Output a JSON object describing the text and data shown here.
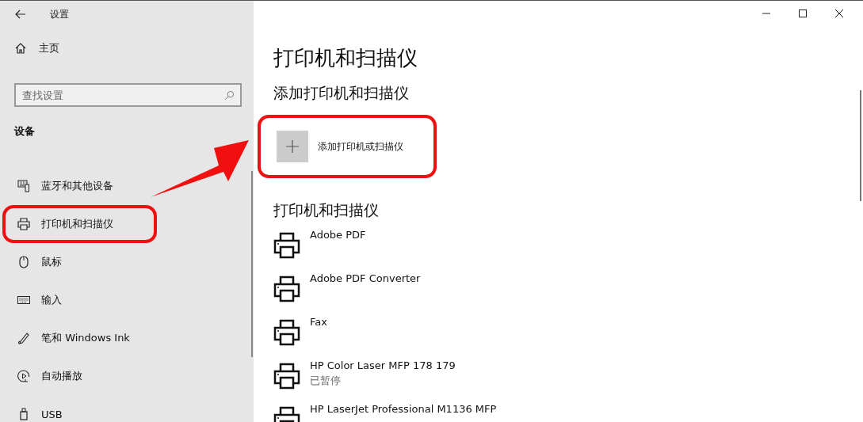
{
  "window": {
    "title": "设置"
  },
  "sidebar": {
    "home": "主页",
    "search": {
      "placeholder": "查找设置"
    },
    "section": "设备",
    "items": [
      {
        "kind": "bluetooth",
        "label": "蓝牙和其他设备",
        "highlighted": false
      },
      {
        "kind": "printer",
        "label": "打印机和扫描仪",
        "highlighted": true
      },
      {
        "kind": "mouse",
        "label": "鼠标",
        "highlighted": false
      },
      {
        "kind": "keyboard",
        "label": "输入",
        "highlighted": false
      },
      {
        "kind": "pen",
        "label": "笔和 Windows Ink",
        "highlighted": false
      },
      {
        "kind": "autoplay",
        "label": "自动播放",
        "highlighted": false
      },
      {
        "kind": "usb",
        "label": "USB",
        "highlighted": false
      }
    ]
  },
  "main": {
    "title": "打印机和扫描仪",
    "add_section": "添加打印机和扫描仪",
    "add_button": {
      "label": "添加打印机或扫描仪",
      "highlighted": true
    },
    "list_section": "打印机和扫描仪",
    "printers": [
      {
        "name": "Adobe PDF"
      },
      {
        "name": "Adobe PDF Converter"
      },
      {
        "name": "Fax"
      },
      {
        "name": "HP Color Laser MFP 178 179",
        "status": "已暂停"
      },
      {
        "name": "HP LaserJet Professional M1136 MFP"
      }
    ]
  }
}
